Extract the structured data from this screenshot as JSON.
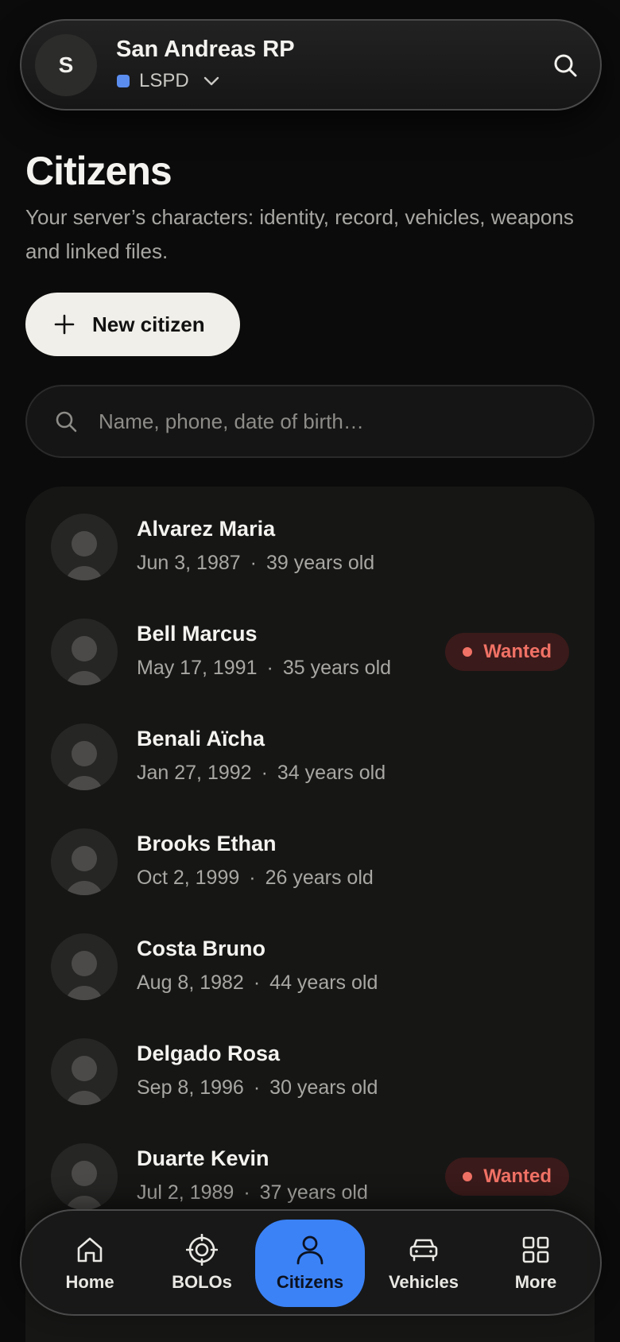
{
  "server": {
    "avatar_initial": "S",
    "name": "San Andreas RP",
    "department": "LSPD",
    "department_color": "#5b8def"
  },
  "page": {
    "title": "Citizens",
    "subtitle": "Your server’s characters: identity, record, vehicles, weapons and linked files."
  },
  "actions": {
    "new_citizen_label": "New citizen"
  },
  "search": {
    "placeholder": "Name, phone, date of birth…"
  },
  "citizens": [
    {
      "name": "Alvarez Maria",
      "dob": "Jun 3, 1987",
      "age": "39 years old",
      "status": ""
    },
    {
      "name": "Bell Marcus",
      "dob": "May 17, 1991",
      "age": "35 years old",
      "status": "Wanted"
    },
    {
      "name": "Benali Aïcha",
      "dob": "Jan 27, 1992",
      "age": "34 years old",
      "status": ""
    },
    {
      "name": "Brooks Ethan",
      "dob": "Oct 2, 1999",
      "age": "26 years old",
      "status": ""
    },
    {
      "name": "Costa Bruno",
      "dob": "Aug 8, 1982",
      "age": "44 years old",
      "status": ""
    },
    {
      "name": "Delgado Rosa",
      "dob": "Sep 8, 1996",
      "age": "30 years old",
      "status": ""
    },
    {
      "name": "Duarte Kevin",
      "dob": "Jul 2, 1989",
      "age": "37 years old",
      "status": "Wanted"
    }
  ],
  "meta_separator": "·",
  "nav": {
    "items": [
      {
        "label": "Home",
        "icon": "home-icon"
      },
      {
        "label": "BOLOs",
        "icon": "target-icon"
      },
      {
        "label": "Citizens",
        "icon": "person-icon",
        "active": true
      },
      {
        "label": "Vehicles",
        "icon": "car-icon"
      },
      {
        "label": "More",
        "icon": "grid-icon"
      }
    ]
  },
  "colors": {
    "background": "#0b0b0b",
    "accent": "#3b82f6",
    "wanted": "#f07165"
  }
}
